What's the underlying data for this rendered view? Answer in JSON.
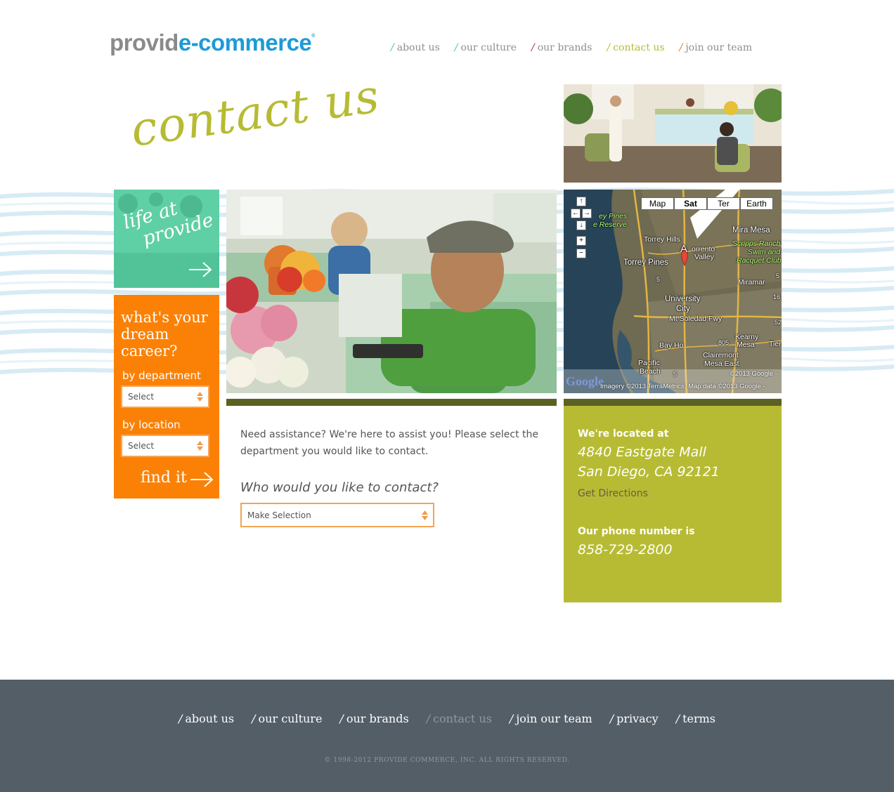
{
  "brand": {
    "logo_part1": "provid",
    "logo_part2": "e-commerce",
    "logo_mark": "®"
  },
  "colors": {
    "accent_green": "#b7bb34",
    "orange": "#fb8106",
    "teal": "#57cba0",
    "brand_blue": "#1d9bd6",
    "footer_bg": "#545e67",
    "bar_olive": "#5b6122"
  },
  "nav": {
    "slash": "/",
    "items": [
      {
        "label": "about us",
        "slash_color": "#57b4c7"
      },
      {
        "label": "our culture",
        "slash_color": "#57b4c7"
      },
      {
        "label": "our brands",
        "slash_color": "#b43131"
      },
      {
        "label": "contact us",
        "slash_color": "#b7bb34"
      },
      {
        "label": "join our team",
        "slash_color": "#e07a1d"
      }
    ],
    "active": "contact us"
  },
  "page": {
    "headline": "contact us"
  },
  "life_tile": {
    "line1": "life at",
    "line2": "provide",
    "icon": "arrow-right-icon"
  },
  "career": {
    "title": "what's your dream career?",
    "by_department": "by department",
    "department_value": "Select",
    "by_location": "by location",
    "location_value": "Select",
    "find_label": "find it"
  },
  "content": {
    "intro": "Need assistance? We're here to assist you! Please select the department you would like to contact.",
    "question": "Who would you like to contact?",
    "contact_select": "Make Selection"
  },
  "map": {
    "types": [
      "Map",
      "Sat",
      "Ter",
      "Earth"
    ],
    "active_type": "Sat",
    "pan_icons": [
      "arrow-up-icon",
      "arrow-left-icon",
      "arrow-right-icon",
      "arrow-down-icon"
    ],
    "zoom_in": "+",
    "zoom_out": "−",
    "marker": "A",
    "labels": {
      "ey_pines": "ey Pines",
      "e_reserve": "e Reserve",
      "torrey_hills": "Torrey Hills",
      "torrey_pines": "Torrey Pines",
      "sorrento1": "orrento",
      "sorrento2": "Valley",
      "mira_mesa": "Mira Mesa",
      "scripps1": "Scripps Ranch",
      "scripps2": "Swim and",
      "scripps3": "Racquet Club",
      "miramar": "Miramar",
      "university1": "University",
      "university2": "City",
      "soledad": "Mt Soledad Fwy",
      "bay_ho": "Bay Ho",
      "kearny1": "Kearny",
      "kearny2": "Mesa",
      "tierra": "Tier",
      "pacific1": "Pacific",
      "pacific2": "Beach",
      "clairemont1": "Clairemont",
      "clairemont2": "Mesa East",
      "hwy5a": "5",
      "hwy5b": "5",
      "hwy805": "805",
      "hwy163": "16",
      "hwy52": "52",
      "hwy15": "5"
    },
    "google": "Google",
    "copyright": "©2013 Google -",
    "attribution": "Imagery ©2013 TerraMetrics, Map data ©2013 Google -"
  },
  "info": {
    "located_label": "We're located at",
    "address1": "4840 Eastgate Mall",
    "address2": "San Diego, CA 92121",
    "directions": "Get Directions",
    "phone_label": "Our phone number is",
    "phone": "858-729-2800"
  },
  "footer": {
    "slash": "/",
    "items": [
      "about us",
      "our culture",
      "our brands",
      "contact us",
      "join our team",
      "privacy",
      "terms"
    ],
    "active": "contact us",
    "copyright": "© 1998-2012 PROVIDE COMMERCE, INC. ALL RIGHTS RESERVED."
  }
}
